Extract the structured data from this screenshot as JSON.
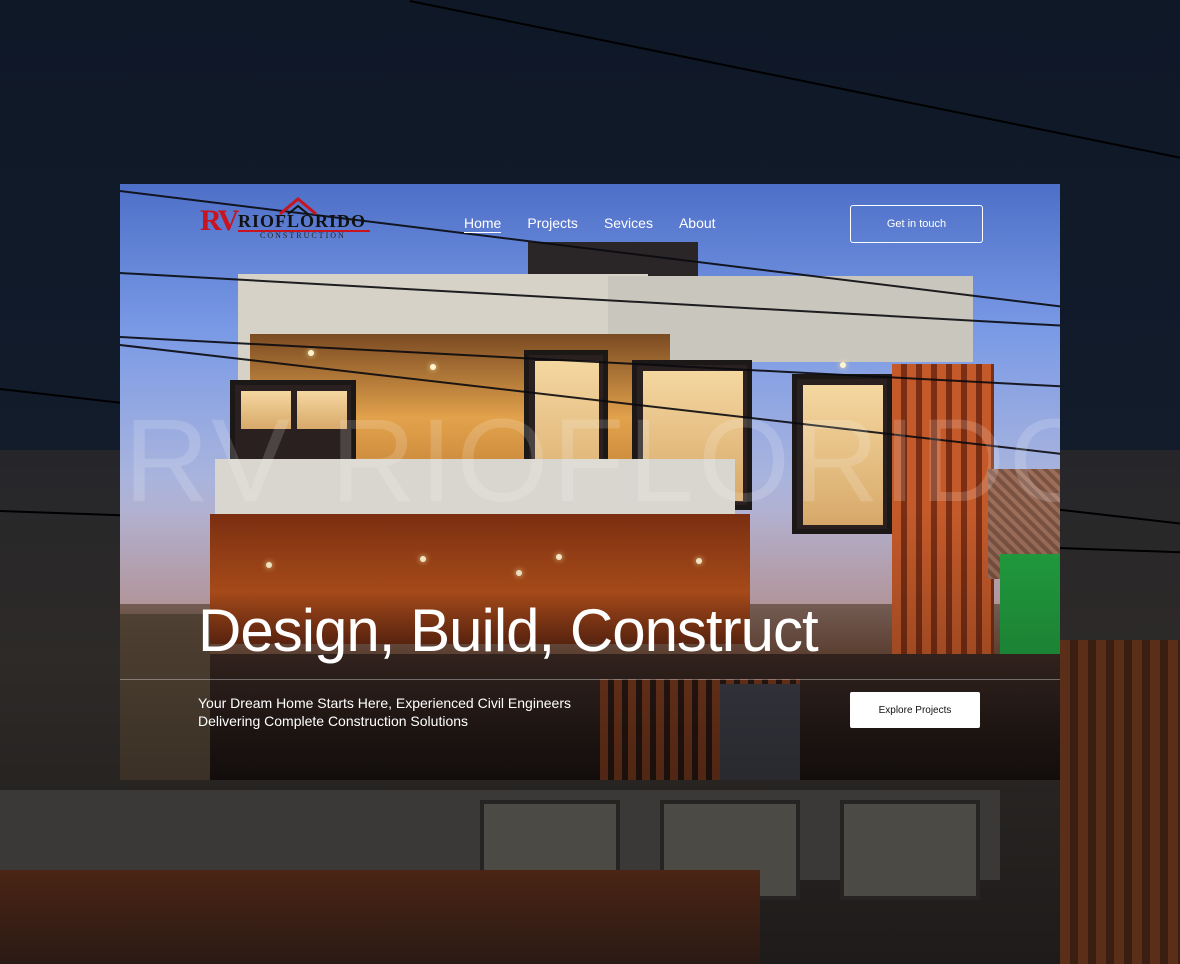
{
  "brand": {
    "monogram": "RV",
    "name": "RIOFLORIDO",
    "tagline": "CONSTRUCTION",
    "watermark": "RV RIOFLORIDO"
  },
  "nav": {
    "items": [
      {
        "label": "Home",
        "active": true
      },
      {
        "label": "Projects",
        "active": false
      },
      {
        "label": "Sevices",
        "active": false
      },
      {
        "label": "About",
        "active": false
      }
    ],
    "cta_label": "Get in touch"
  },
  "hero": {
    "headline": "Design, Build, Construct",
    "subtext": "Your Dream Home Starts Here, Experienced Civil Engineers Delivering Complete Construction Solutions",
    "cta_label": "Explore Projects"
  },
  "colors": {
    "page_background": "#101826",
    "brand_red": "#c8141e",
    "text_on_hero": "#ffffff"
  },
  "icons": [
    "roof-logo-icon"
  ]
}
